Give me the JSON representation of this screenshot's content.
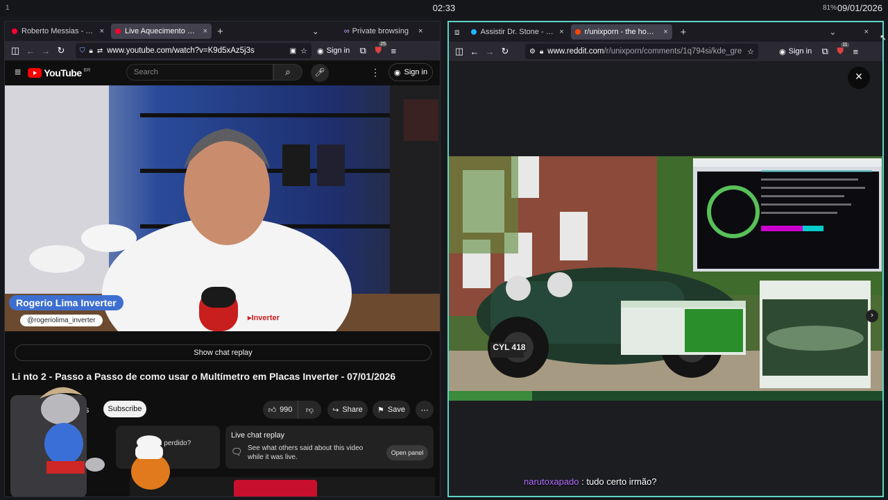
{
  "system": {
    "workspace": "1",
    "clock": "02:33",
    "battery": "81%",
    "date": "09/01/2026"
  },
  "left": {
    "tabs": [
      {
        "title": "Roberto Messias - YouT",
        "close": "×",
        "color": "#ff0033"
      },
      {
        "title": "Live Aquecimento 2 - P",
        "close": "×",
        "color": "#ff0033"
      }
    ],
    "new_tab": "+",
    "tab_list": "⌄",
    "private_label": "Private browsing",
    "url": "www.youtube.com/watch?v=K9d5xAz5j3s",
    "signin": "Sign in",
    "ext_badge": "25",
    "yt": {
      "word": "YouTube",
      "region": "BR",
      "search_placeholder": "Search",
      "signin": "Sign in",
      "video_overlay_name": "Rogerio Lima Inverter",
      "video_overlay_handle": "@rogeriolima_inverter",
      "show_chat_replay": "Show chat replay",
      "title": "Li           nto 2 - Passo a Passo de como usar o Multímetro em Placas Inverter - 07/01/2026",
      "channel_fragment": "sias",
      "subscribe": "Subscribe",
      "likes": "990",
      "share": "Share",
      "save": "Save",
      "card_left_text": "tiu perdido?",
      "card_title": "Live chat replay",
      "card_desc": "See what others said about this video while it was live.",
      "open_panel": "Open panel"
    }
  },
  "right": {
    "tabs": [
      {
        "title": "Assistir Dr. Stone - Epis",
        "close": "×",
        "color": "#1fb6ff"
      },
      {
        "title": "r/unixporn - the home fo",
        "close": "×",
        "color": "#ff4500"
      }
    ],
    "new_tab": "+",
    "tab_list": "⌄",
    "url_host": "www.reddit.com",
    "url_path": "/r/unixporn/comments/1q794si/kde_gre",
    "signin": "Sign in",
    "ext_badge": "11",
    "close_viewer": "×",
    "photo_plate": "CYL 418",
    "comment_user": "narutoxapado",
    "comment_text": ": tudo certo irmão?"
  },
  "colors": {
    "accent": "#5ed6c6",
    "yt_red": "#ff0000",
    "reddit": "#ff4500",
    "username": "#b26cff"
  }
}
